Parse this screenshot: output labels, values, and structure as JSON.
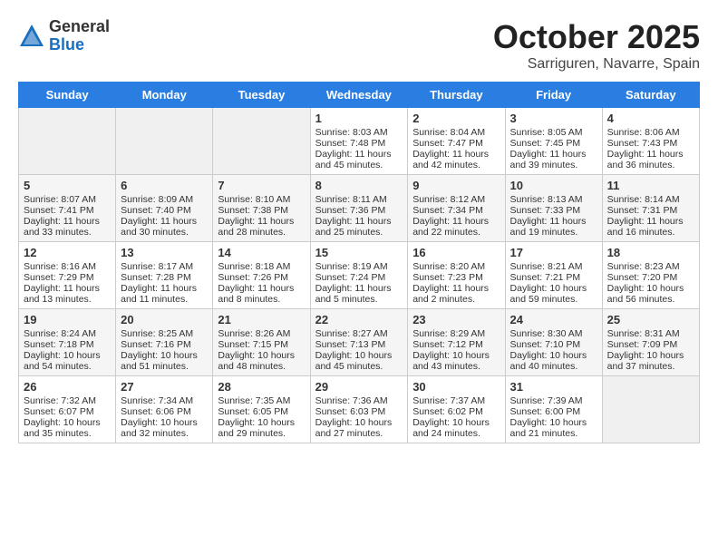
{
  "header": {
    "logo_general": "General",
    "logo_blue": "Blue",
    "month_title": "October 2025",
    "location": "Sarriguren, Navarre, Spain"
  },
  "days_of_week": [
    "Sunday",
    "Monday",
    "Tuesday",
    "Wednesday",
    "Thursday",
    "Friday",
    "Saturday"
  ],
  "weeks": [
    [
      {
        "day": "",
        "info": ""
      },
      {
        "day": "",
        "info": ""
      },
      {
        "day": "",
        "info": ""
      },
      {
        "day": "1",
        "info": "Sunrise: 8:03 AM\nSunset: 7:48 PM\nDaylight: 11 hours and 45 minutes."
      },
      {
        "day": "2",
        "info": "Sunrise: 8:04 AM\nSunset: 7:47 PM\nDaylight: 11 hours and 42 minutes."
      },
      {
        "day": "3",
        "info": "Sunrise: 8:05 AM\nSunset: 7:45 PM\nDaylight: 11 hours and 39 minutes."
      },
      {
        "day": "4",
        "info": "Sunrise: 8:06 AM\nSunset: 7:43 PM\nDaylight: 11 hours and 36 minutes."
      }
    ],
    [
      {
        "day": "5",
        "info": "Sunrise: 8:07 AM\nSunset: 7:41 PM\nDaylight: 11 hours and 33 minutes."
      },
      {
        "day": "6",
        "info": "Sunrise: 8:09 AM\nSunset: 7:40 PM\nDaylight: 11 hours and 30 minutes."
      },
      {
        "day": "7",
        "info": "Sunrise: 8:10 AM\nSunset: 7:38 PM\nDaylight: 11 hours and 28 minutes."
      },
      {
        "day": "8",
        "info": "Sunrise: 8:11 AM\nSunset: 7:36 PM\nDaylight: 11 hours and 25 minutes."
      },
      {
        "day": "9",
        "info": "Sunrise: 8:12 AM\nSunset: 7:34 PM\nDaylight: 11 hours and 22 minutes."
      },
      {
        "day": "10",
        "info": "Sunrise: 8:13 AM\nSunset: 7:33 PM\nDaylight: 11 hours and 19 minutes."
      },
      {
        "day": "11",
        "info": "Sunrise: 8:14 AM\nSunset: 7:31 PM\nDaylight: 11 hours and 16 minutes."
      }
    ],
    [
      {
        "day": "12",
        "info": "Sunrise: 8:16 AM\nSunset: 7:29 PM\nDaylight: 11 hours and 13 minutes."
      },
      {
        "day": "13",
        "info": "Sunrise: 8:17 AM\nSunset: 7:28 PM\nDaylight: 11 hours and 11 minutes."
      },
      {
        "day": "14",
        "info": "Sunrise: 8:18 AM\nSunset: 7:26 PM\nDaylight: 11 hours and 8 minutes."
      },
      {
        "day": "15",
        "info": "Sunrise: 8:19 AM\nSunset: 7:24 PM\nDaylight: 11 hours and 5 minutes."
      },
      {
        "day": "16",
        "info": "Sunrise: 8:20 AM\nSunset: 7:23 PM\nDaylight: 11 hours and 2 minutes."
      },
      {
        "day": "17",
        "info": "Sunrise: 8:21 AM\nSunset: 7:21 PM\nDaylight: 10 hours and 59 minutes."
      },
      {
        "day": "18",
        "info": "Sunrise: 8:23 AM\nSunset: 7:20 PM\nDaylight: 10 hours and 56 minutes."
      }
    ],
    [
      {
        "day": "19",
        "info": "Sunrise: 8:24 AM\nSunset: 7:18 PM\nDaylight: 10 hours and 54 minutes."
      },
      {
        "day": "20",
        "info": "Sunrise: 8:25 AM\nSunset: 7:16 PM\nDaylight: 10 hours and 51 minutes."
      },
      {
        "day": "21",
        "info": "Sunrise: 8:26 AM\nSunset: 7:15 PM\nDaylight: 10 hours and 48 minutes."
      },
      {
        "day": "22",
        "info": "Sunrise: 8:27 AM\nSunset: 7:13 PM\nDaylight: 10 hours and 45 minutes."
      },
      {
        "day": "23",
        "info": "Sunrise: 8:29 AM\nSunset: 7:12 PM\nDaylight: 10 hours and 43 minutes."
      },
      {
        "day": "24",
        "info": "Sunrise: 8:30 AM\nSunset: 7:10 PM\nDaylight: 10 hours and 40 minutes."
      },
      {
        "day": "25",
        "info": "Sunrise: 8:31 AM\nSunset: 7:09 PM\nDaylight: 10 hours and 37 minutes."
      }
    ],
    [
      {
        "day": "26",
        "info": "Sunrise: 7:32 AM\nSunset: 6:07 PM\nDaylight: 10 hours and 35 minutes."
      },
      {
        "day": "27",
        "info": "Sunrise: 7:34 AM\nSunset: 6:06 PM\nDaylight: 10 hours and 32 minutes."
      },
      {
        "day": "28",
        "info": "Sunrise: 7:35 AM\nSunset: 6:05 PM\nDaylight: 10 hours and 29 minutes."
      },
      {
        "day": "29",
        "info": "Sunrise: 7:36 AM\nSunset: 6:03 PM\nDaylight: 10 hours and 27 minutes."
      },
      {
        "day": "30",
        "info": "Sunrise: 7:37 AM\nSunset: 6:02 PM\nDaylight: 10 hours and 24 minutes."
      },
      {
        "day": "31",
        "info": "Sunrise: 7:39 AM\nSunset: 6:00 PM\nDaylight: 10 hours and 21 minutes."
      },
      {
        "day": "",
        "info": ""
      }
    ]
  ]
}
